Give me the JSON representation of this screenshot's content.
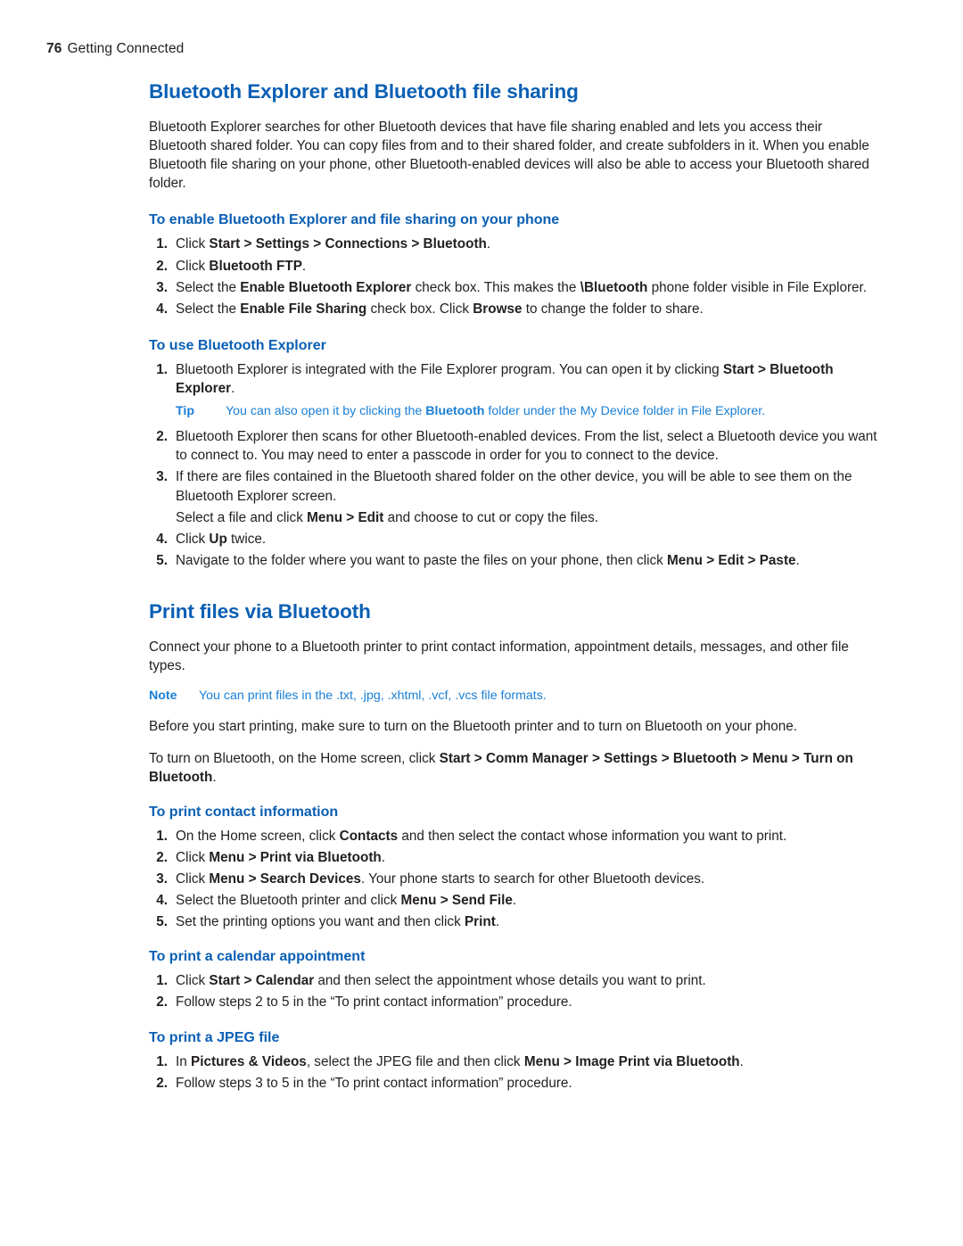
{
  "header": {
    "page_number": "76",
    "section": "Getting Connected"
  },
  "sections": {
    "bt_explorer": {
      "title": "Bluetooth Explorer and Bluetooth file sharing",
      "intro": "Bluetooth Explorer searches for other Bluetooth devices that have file sharing enabled and lets you access their Bluetooth shared folder. You can copy files from and to their shared folder, and create subfolders in it. When you enable Bluetooth file sharing on your phone, other Bluetooth-enabled devices will also be able to access your Bluetooth shared folder.",
      "enable_heading": "To enable Bluetooth Explorer and file sharing on your phone",
      "enable_steps": [
        {
          "num": "1.",
          "html": "Click <b>Start &gt; Settings &gt; Connections &gt; Bluetooth</b>."
        },
        {
          "num": "2.",
          "html": "Click <b>Bluetooth FTP</b>."
        },
        {
          "num": "3.",
          "html": "Select the <b>Enable Bluetooth Explorer</b> check box. This makes the <b>\\Bluetooth</b> phone folder visible in File Explorer."
        },
        {
          "num": "4.",
          "html": "Select the <b>Enable File Sharing</b> check box. Click <b>Browse</b> to change the folder to share."
        }
      ],
      "use_heading": "To use Bluetooth Explorer",
      "use_steps_1": [
        {
          "num": "1.",
          "html": "Bluetooth Explorer is integrated with the File Explorer program. You can open it by clicking <b>Start &gt; Bluetooth Explorer</b>."
        }
      ],
      "tip": {
        "label": "Tip",
        "html": "You can also open it by clicking the <b>Bluetooth</b> folder under the My Device folder in File Explorer."
      },
      "use_steps_2": [
        {
          "num": "2.",
          "html": "Bluetooth Explorer then scans for other Bluetooth-enabled devices. From the list, select a Bluetooth device you want to connect to. You may need to enter a passcode in order for you to connect to the device."
        },
        {
          "num": "3.",
          "html": "If there are files contained in the Bluetooth shared folder on the other device, you will be able to see them on the Bluetooth Explorer screen."
        }
      ],
      "step3_continuation": "Select a file and click <b>Menu &gt; Edit</b> and choose to cut or copy the files.",
      "use_steps_3": [
        {
          "num": "4.",
          "html": "Click <b>Up</b> twice."
        },
        {
          "num": "5.",
          "html": "Navigate to the folder where you want to paste the files on your phone, then click <b>Menu &gt; Edit &gt; Paste</b>."
        }
      ]
    },
    "print_bt": {
      "title": "Print files via Bluetooth",
      "intro": "Connect your phone to a Bluetooth printer to print contact information, appointment details, messages, and other file types.",
      "note": {
        "label": "Note",
        "html": "You can print files in the .txt, .jpg, .xhtml, .vcf, .vcs file formats."
      },
      "before_para": "Before you start printing, make sure to turn on the Bluetooth printer and to turn on Bluetooth on your phone.",
      "turnon_para": "To turn on Bluetooth, on the Home screen, click <b>Start &gt; Comm Manager &gt; Settings &gt; Bluetooth &gt; Menu &gt; Turn on Bluetooth</b>.",
      "contact_heading": "To print contact information",
      "contact_steps": [
        {
          "num": "1.",
          "html": "On the Home screen, click <b>Contacts</b> and then select the contact whose information you want to print."
        },
        {
          "num": "2.",
          "html": "Click <b>Menu &gt; Print via Bluetooth</b>."
        },
        {
          "num": "3.",
          "html": "Click <b>Menu &gt; Search Devices</b>. Your phone starts to search for other Bluetooth devices."
        },
        {
          "num": "4.",
          "html": "Select the Bluetooth printer and click <b>Menu &gt; Send File</b>."
        },
        {
          "num": "5.",
          "html": "Set the printing options you want and then click <b>Print</b>."
        }
      ],
      "calendar_heading": "To print a calendar appointment",
      "calendar_steps": [
        {
          "num": "1.",
          "html": "Click <b>Start &gt; Calendar</b> and then select the appointment whose details you want to print."
        },
        {
          "num": "2.",
          "html": "Follow steps 2 to 5 in the “To print contact information” procedure."
        }
      ],
      "jpeg_heading": "To print a JPEG file",
      "jpeg_steps": [
        {
          "num": "1.",
          "html": "In <b>Pictures &amp; Videos</b>, select the JPEG file and then click <b>Menu &gt; Image Print via Bluetooth</b>."
        },
        {
          "num": "2.",
          "html": "Follow steps 3 to 5 in the “To print contact information” procedure."
        }
      ]
    }
  },
  "colors": {
    "heading_blue": "#0a5fb4",
    "tip_blue": "#1a7fd4",
    "body_text": "#231f20"
  }
}
